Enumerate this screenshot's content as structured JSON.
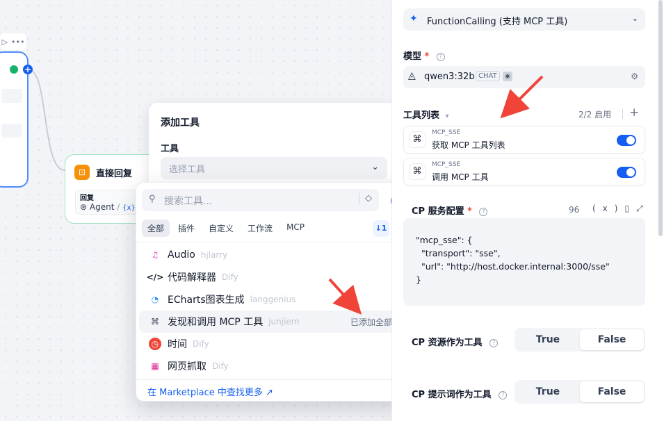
{
  "canvas": {
    "reply_node": {
      "title": "直接回复",
      "field_label": "回复",
      "var_name": "Agent",
      "var_sep": "/",
      "var_icon": "{x}"
    }
  },
  "add_tool": {
    "title": "添加工具",
    "section": "工具",
    "select_placeholder": "选择工具"
  },
  "tool_picker": {
    "search_placeholder": "搜索工具...",
    "tabs": [
      "全部",
      "插件",
      "自定义",
      "工作流",
      "MCP"
    ],
    "items": [
      {
        "name": "Audio",
        "author": "hjlarry",
        "icon": "audio-icon"
      },
      {
        "name": "代码解释器",
        "author": "Dify",
        "icon": "code-icon"
      },
      {
        "name": "ECharts图表生成",
        "author": "langgenius",
        "icon": "echarts-icon"
      },
      {
        "name": "发现和调用 MCP 工具",
        "author": "junjiem",
        "icon": "mcp-icon",
        "status": "已添加全部"
      },
      {
        "name": "时间",
        "author": "Dify",
        "icon": "clock-icon"
      },
      {
        "name": "网页抓取",
        "author": "Dify",
        "icon": "web-scraper-icon"
      }
    ],
    "marketplace_link": "在 Marketplace 中查找更多 ↗"
  },
  "panel": {
    "strategy": "FunctionCalling (支持 MCP 工具)",
    "model_label": "模型",
    "model_name": "qwen3:32b",
    "model_badge": "CHAT",
    "tools_label": "工具列表",
    "tools_count": "2/2 启用",
    "tools": [
      {
        "provider": "MCP_SSE",
        "name": "获取 MCP 工具列表",
        "enabled": true
      },
      {
        "provider": "MCP_SSE",
        "name": "调用 MCP 工具",
        "enabled": true
      }
    ],
    "config_label": "CP 服务配置",
    "config_count": "96",
    "config_code": "\"mcp_sse\": {\n  \"transport\": \"sse\",\n  \"url\": \"http://host.docker.internal:3000/sse\"\n}",
    "options": [
      {
        "label": "CP 资源作为工具",
        "true_label": "True",
        "false_label": "False"
      },
      {
        "label": "CP 提示词作为工具",
        "true_label": "True",
        "false_label": "False"
      }
    ]
  },
  "colors": {
    "accent": "#155eef",
    "annotation": "#f04438"
  }
}
